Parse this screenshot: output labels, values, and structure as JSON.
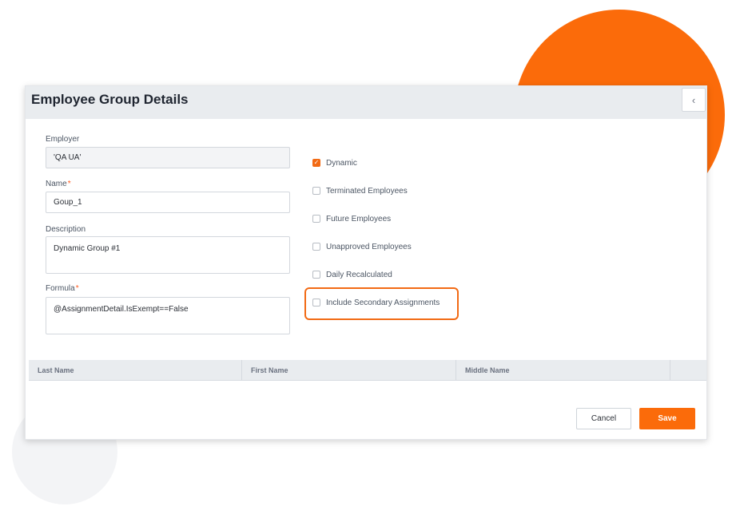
{
  "colors": {
    "accent": "#fb6b0a",
    "header_bg": "#e9ecef"
  },
  "dialog": {
    "title": "Employee Group Details",
    "collapse_icon": "chevron-left-icon"
  },
  "form": {
    "employer": {
      "label": "Employer",
      "value": "'QA UA'"
    },
    "name": {
      "label": "Name",
      "required_mark": "*",
      "value": "Goup_1"
    },
    "description": {
      "label": "Description",
      "value": "Dynamic Group #1"
    },
    "formula": {
      "label": "Formula",
      "required_mark": "*",
      "value": "@AssignmentDetail.IsExempt==False"
    }
  },
  "options": [
    {
      "label": "Dynamic",
      "checked": true
    },
    {
      "label": "Terminated Employees",
      "checked": false
    },
    {
      "label": "Future Employees",
      "checked": false
    },
    {
      "label": "Unapproved Employees",
      "checked": false
    },
    {
      "label": "Daily Recalculated",
      "checked": false
    },
    {
      "label": "Include Secondary Assignments",
      "checked": false
    }
  ],
  "grid": {
    "columns": [
      "Last Name",
      "First Name",
      "Middle Name"
    ]
  },
  "actions": {
    "cancel_label": "Cancel",
    "save_label": "Save"
  }
}
